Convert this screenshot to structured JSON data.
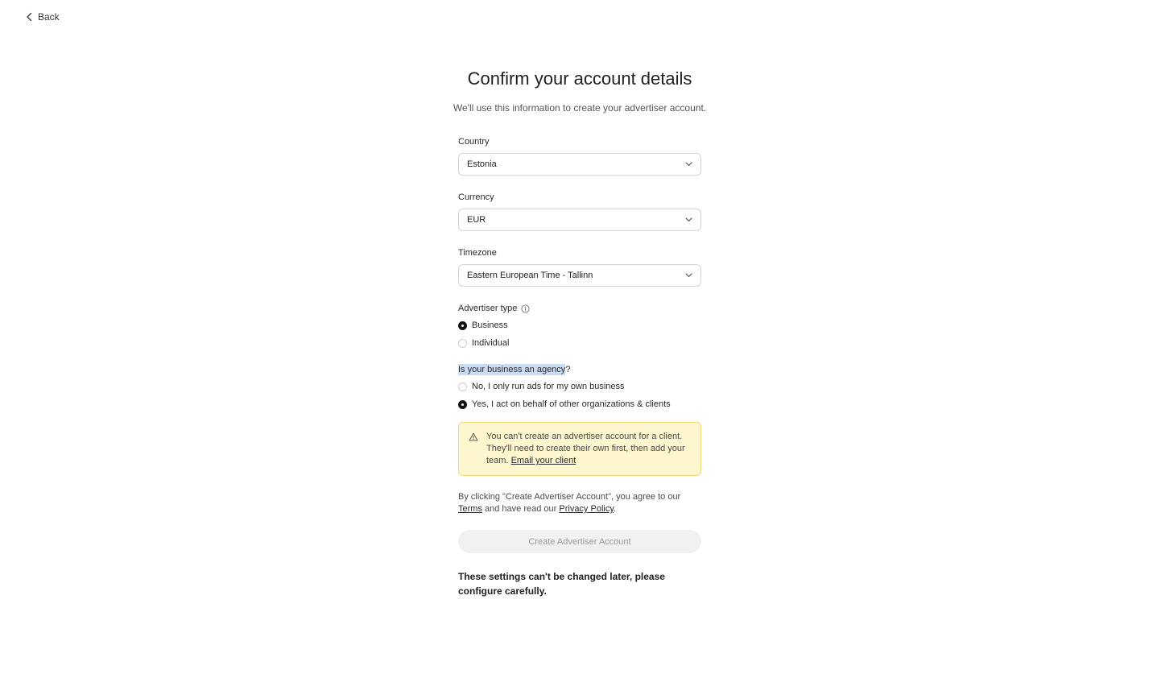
{
  "nav": {
    "back_label": "Back"
  },
  "header": {
    "title": "Confirm your account details",
    "subtitle": "We'll use this information to create your advertiser account."
  },
  "form": {
    "country": {
      "label": "Country",
      "value": "Estonia"
    },
    "currency": {
      "label": "Currency",
      "value": "EUR"
    },
    "timezone": {
      "label": "Timezone",
      "value": "Eastern European Time - Tallinn"
    },
    "advertiser_type": {
      "label": "Advertiser type",
      "options": [
        {
          "label": "Business",
          "selected": true
        },
        {
          "label": "Individual",
          "selected": false
        }
      ]
    },
    "agency": {
      "label_highlighted": "Is your business an agency",
      "label_rest": "?",
      "options": [
        {
          "label": "No, I only run ads for my own business",
          "selected": false
        },
        {
          "label": "Yes, I act on behalf of other organizations & clients",
          "selected": true
        }
      ]
    }
  },
  "warning": {
    "text": "You can't create an advertiser account for a client. They'll need to create their own first, then add your team.",
    "link_label": "Email your client"
  },
  "legal": {
    "prefix": "By clicking \"Create Advertiser Account\", you agree to our",
    "terms_label": "Terms",
    "middle": "and have read our",
    "privacy_label": "Privacy Policy",
    "suffix": "."
  },
  "actions": {
    "create_label": "Create Advertiser Account"
  },
  "note": "These settings can't be changed later, please configure carefully.",
  "colors": {
    "warning_bg": "#fdf6cf",
    "warning_border": "#f0d77a",
    "disabled_button_bg": "#f1f1f1",
    "selection_highlight": "#c9dcf3"
  },
  "icons": {
    "back": "chevron-left-icon",
    "select": "chevron-down-icon",
    "info": "info-icon",
    "warning": "warning-triangle-icon"
  }
}
